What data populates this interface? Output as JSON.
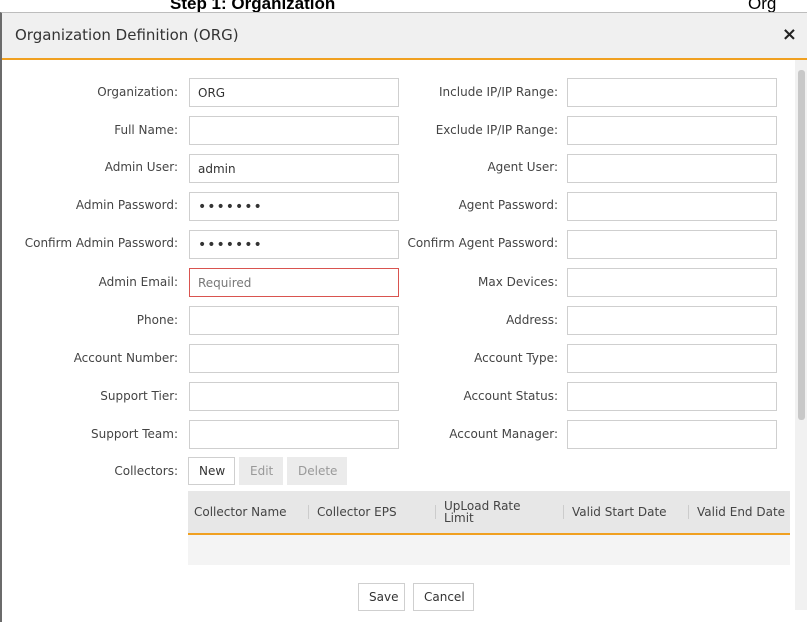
{
  "background": {
    "title_left": "Step 1: Organization",
    "title_right": "Org"
  },
  "dialog": {
    "title": "Organization Definition (ORG)",
    "close": "×"
  },
  "left_fields": [
    {
      "label": "Organization:",
      "value": "ORG",
      "placeholder": ""
    },
    {
      "label": "Full Name:",
      "value": "",
      "placeholder": ""
    },
    {
      "label": "Admin User:",
      "value": "admin",
      "placeholder": ""
    },
    {
      "label": "Admin Password:",
      "value": "•••••••",
      "placeholder": ""
    },
    {
      "label": "Confirm Admin Password:",
      "value": "•••••••",
      "placeholder": ""
    },
    {
      "label": "Admin Email:",
      "value": "",
      "placeholder": "Required"
    },
    {
      "label": "Phone:",
      "value": "",
      "placeholder": ""
    },
    {
      "label": "Account Number:",
      "value": "",
      "placeholder": ""
    },
    {
      "label": "Support Tier:",
      "value": "",
      "placeholder": ""
    },
    {
      "label": "Support Team:",
      "value": "",
      "placeholder": ""
    }
  ],
  "right_fields": [
    {
      "label": "Include IP/IP Range:",
      "value": ""
    },
    {
      "label": "Exclude IP/IP Range:",
      "value": ""
    },
    {
      "label": "Agent User:",
      "value": ""
    },
    {
      "label": "Agent Password:",
      "value": ""
    },
    {
      "label": "Confirm Agent Password:",
      "value": ""
    },
    {
      "label": "Max Devices:",
      "value": ""
    },
    {
      "label": "Address:",
      "value": ""
    },
    {
      "label": "Account Type:",
      "value": ""
    },
    {
      "label": "Account Status:",
      "value": ""
    },
    {
      "label": "Account Manager:",
      "value": ""
    }
  ],
  "collectors": {
    "label": "Collectors:",
    "buttons": {
      "new": "New",
      "edit": "Edit",
      "delete": "Delete"
    },
    "columns": [
      "Collector Name",
      "Collector EPS",
      "UpLoad Rate Limit",
      "Valid Start Date",
      "Valid End Date"
    ]
  },
  "footer": {
    "save": "Save",
    "cancel": "Cancel"
  },
  "colors": {
    "accent": "#f0a020",
    "error_border": "#d9534f"
  }
}
